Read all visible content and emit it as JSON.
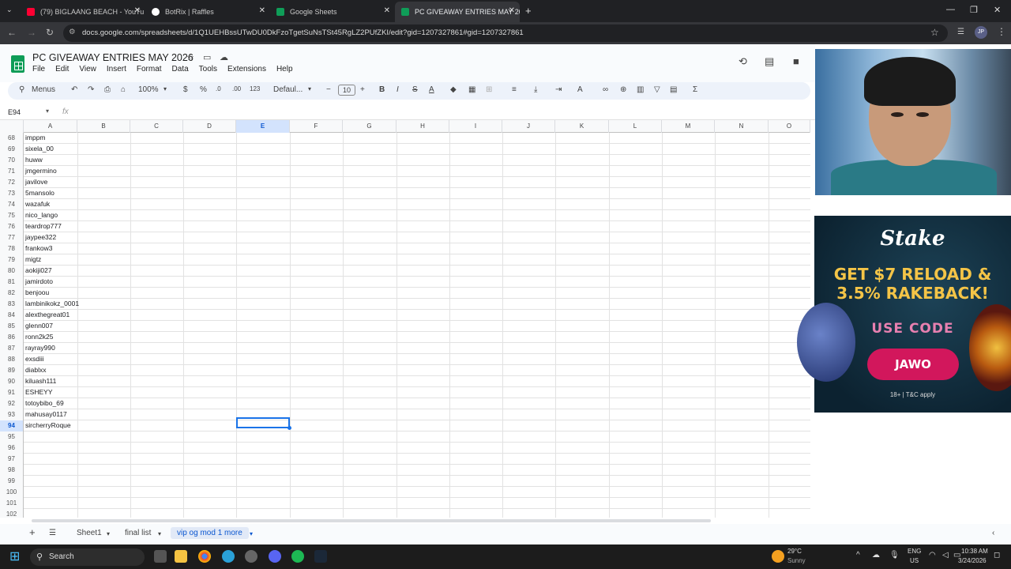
{
  "browser": {
    "tabs": [
      {
        "title": "(79) BIGLAANG BEACH - YouTu",
        "icon": "youtube-icon",
        "color": "#ff0033"
      },
      {
        "title": "BotRix | Raffles",
        "icon": "botrix-icon",
        "color": "#ffffff"
      },
      {
        "title": "Google Sheets",
        "icon": "sheets-icon",
        "color": "#0f9d58"
      },
      {
        "title": "PC GIVEAWAY ENTRIES MAY 20",
        "icon": "sheets-icon",
        "color": "#0f9d58"
      }
    ],
    "url": "docs.google.com/spreadsheets/d/1Q1UEHBssUTwDU0DkFzoTgetSuNsTSt45RgLZ2PUfZKI/edit?gid=1207327861#gid=1207327861",
    "profile": "JP"
  },
  "doc": {
    "title": "PC GIVEAWAY ENTRIES MAY 2026",
    "menus": [
      "File",
      "Edit",
      "View",
      "Insert",
      "Format",
      "Data",
      "Tools",
      "Extensions",
      "Help"
    ]
  },
  "toolbar": {
    "search_label": "Menus",
    "zoom": "100%",
    "currency": "$",
    "percent": "%",
    "dec_down": ".0",
    "dec_up": ".00",
    "number_format": "123",
    "font": "Defaul...",
    "font_size": "10"
  },
  "formula_bar": {
    "cell_ref": "E94",
    "fx": "fx"
  },
  "columns": [
    "A",
    "B",
    "C",
    "D",
    "E",
    "F",
    "G",
    "H",
    "I",
    "J",
    "K",
    "L",
    "M",
    "N",
    "O"
  ],
  "selected_column": "E",
  "rows": [
    {
      "n": "68",
      "a": "imppm"
    },
    {
      "n": "69",
      "a": "sixela_00"
    },
    {
      "n": "70",
      "a": "huww"
    },
    {
      "n": "71",
      "a": "jmgermino"
    },
    {
      "n": "72",
      "a": "javilove"
    },
    {
      "n": "73",
      "a": "5mansolo"
    },
    {
      "n": "74",
      "a": "wazafuk"
    },
    {
      "n": "75",
      "a": "nico_lango"
    },
    {
      "n": "76",
      "a": "teardrop777"
    },
    {
      "n": "77",
      "a": "jaypee322"
    },
    {
      "n": "78",
      "a": "frankow3"
    },
    {
      "n": "79",
      "a": "migtz"
    },
    {
      "n": "80",
      "a": "aokiji027"
    },
    {
      "n": "81",
      "a": "jamirdoto"
    },
    {
      "n": "82",
      "a": "benjoou"
    },
    {
      "n": "83",
      "a": "lambinikokz_0001"
    },
    {
      "n": "84",
      "a": "alexthegreat01"
    },
    {
      "n": "85",
      "a": "glenn007"
    },
    {
      "n": "86",
      "a": "ronn2k25"
    },
    {
      "n": "87",
      "a": "rayray990"
    },
    {
      "n": "88",
      "a": "exsdiii"
    },
    {
      "n": "89",
      "a": "diablxx"
    },
    {
      "n": "90",
      "a": "kiluash111"
    },
    {
      "n": "91",
      "a": "ESHEYY"
    },
    {
      "n": "92",
      "a": "totoybibo_69"
    },
    {
      "n": "93",
      "a": "mahusay0117"
    },
    {
      "n": "94",
      "a": "sircherryRoque"
    },
    {
      "n": "95",
      "a": ""
    },
    {
      "n": "96",
      "a": ""
    },
    {
      "n": "97",
      "a": ""
    },
    {
      "n": "98",
      "a": ""
    },
    {
      "n": "99",
      "a": ""
    },
    {
      "n": "100",
      "a": ""
    },
    {
      "n": "101",
      "a": ""
    },
    {
      "n": "102",
      "a": ""
    }
  ],
  "sheet_tabs": [
    {
      "label": "Sheet1",
      "active": false
    },
    {
      "label": "final list",
      "active": false
    },
    {
      "label": "vip og mod 1 more",
      "active": true
    }
  ],
  "ad": {
    "brand": "Stake",
    "headline_1": "GET $7 RELOAD &",
    "headline_2": "3.5% RAKEBACK!",
    "use_code": "USE CODE",
    "code": "JAWO",
    "fine_print": "18+ | T&C apply"
  },
  "taskbar": {
    "search": "Search",
    "weather_temp": "29°C",
    "weather_desc": "Sunny",
    "lang_1": "ENG",
    "lang_2": "US",
    "time": "10:38 AM",
    "date": "3/24/2026"
  }
}
